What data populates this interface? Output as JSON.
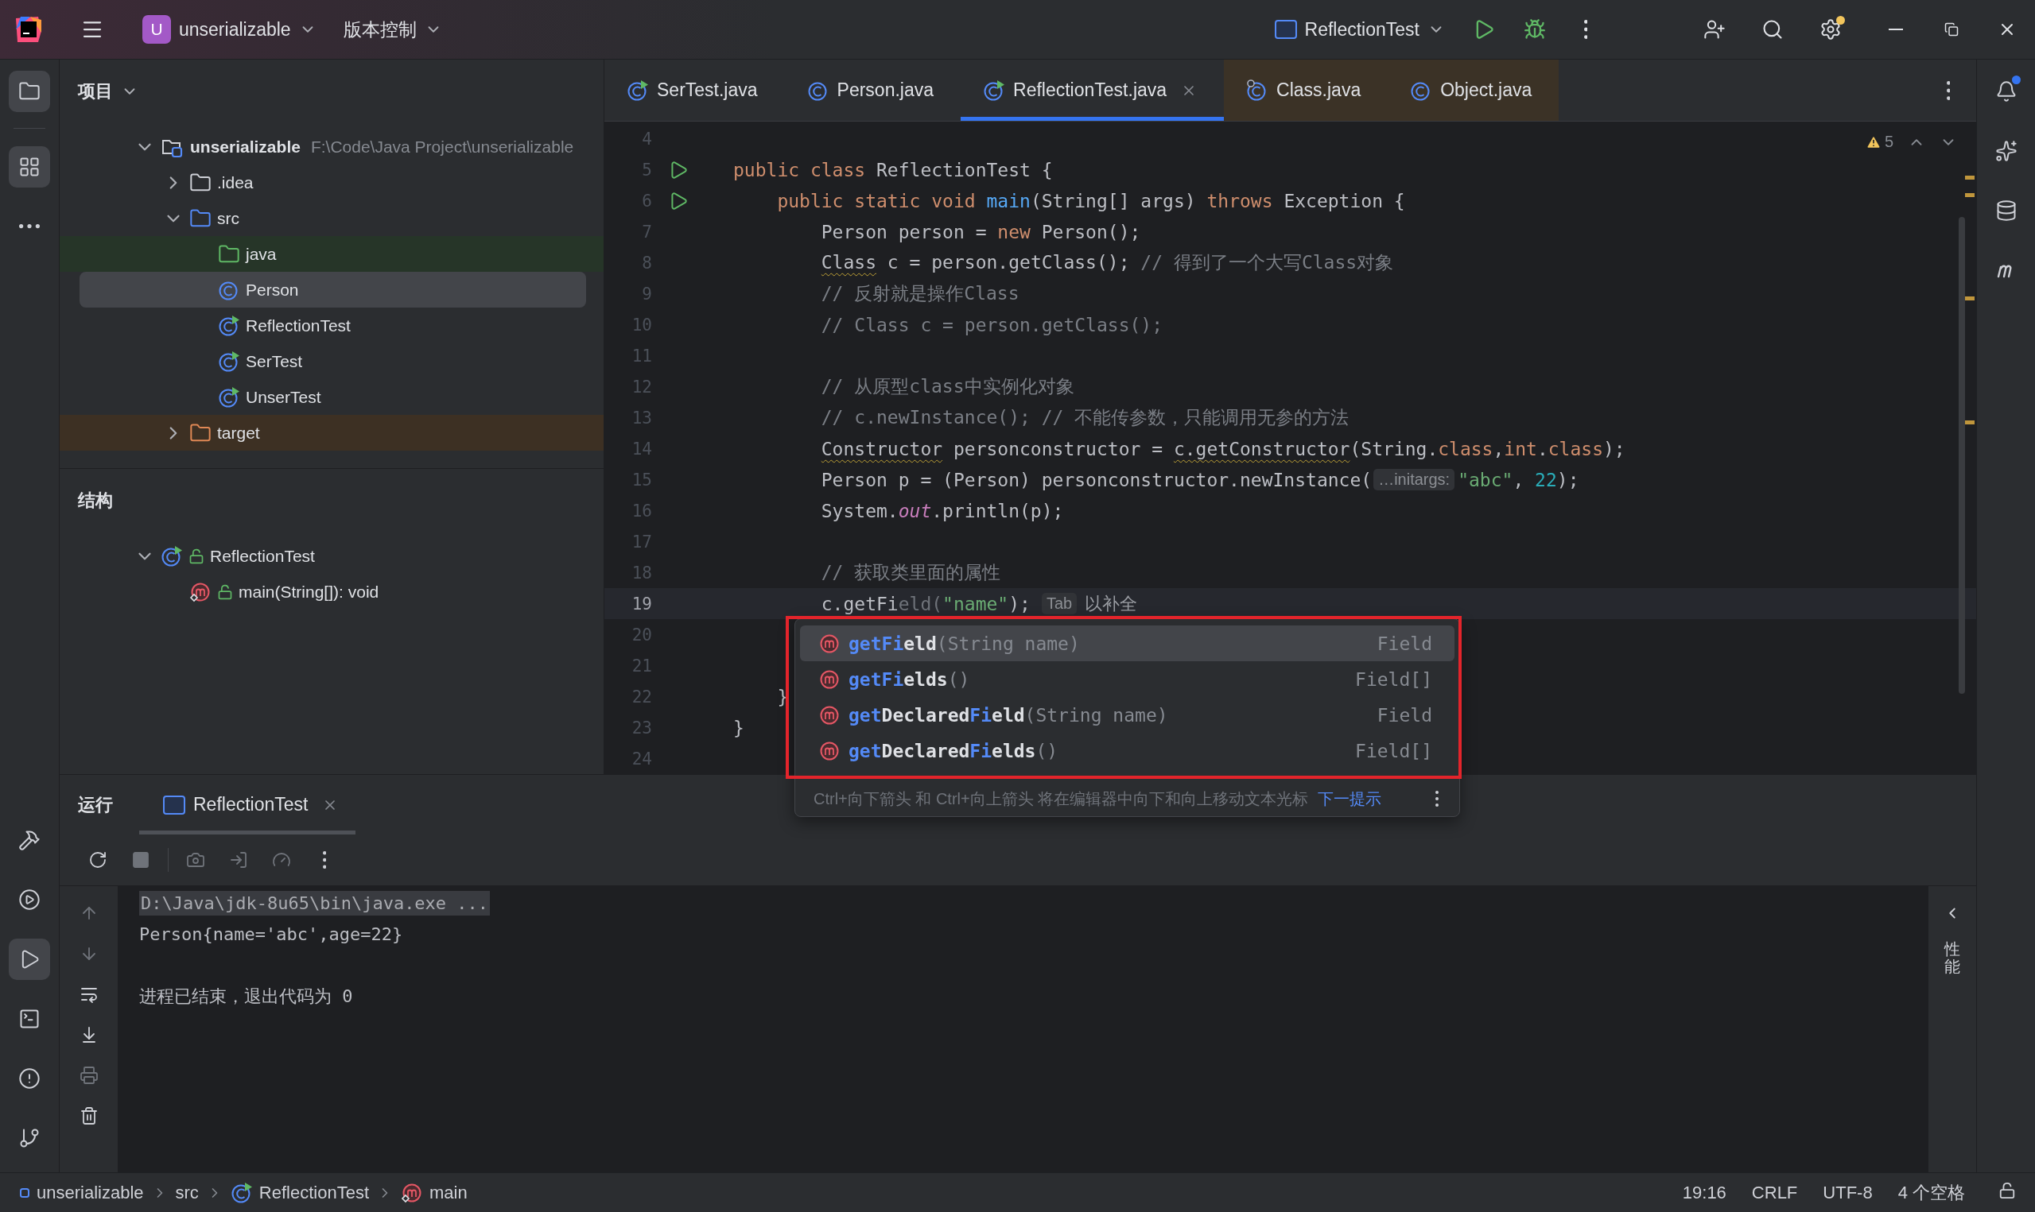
{
  "title_bar": {
    "project": {
      "badge": "U",
      "name": "unserializable"
    },
    "vcs": "版本控制",
    "run_config": "ReflectionTest",
    "settings_badge": true
  },
  "tool_strip": {
    "top": [
      {
        "kind": "project",
        "selected": true
      },
      {
        "kind": "structure",
        "selected": true
      },
      {
        "kind": "more",
        "selected": false
      }
    ],
    "bottom": [
      {
        "kind": "build",
        "selected": false
      },
      {
        "kind": "services",
        "selected": false
      },
      {
        "kind": "run",
        "selected": true
      },
      {
        "kind": "terminal",
        "selected": false
      },
      {
        "kind": "problems",
        "selected": false
      },
      {
        "kind": "git",
        "selected": false
      }
    ]
  },
  "project": {
    "title": "项目",
    "tree": [
      {
        "label": "unserializable",
        "path": "F:\\Code\\Java Project\\unserializable",
        "kind": "module",
        "expanded": true,
        "selected": false,
        "children": [
          {
            "label": ".idea",
            "kind": "folder",
            "expanded": false,
            "selected": false
          },
          {
            "label": "src",
            "kind": "source-folder",
            "expanded": true,
            "selected": false,
            "children": [
              {
                "label": "java",
                "kind": "root-folder",
                "selected": false,
                "color": "#263528"
              },
              {
                "label": "Person",
                "kind": "class",
                "selected": true
              },
              {
                "label": "ReflectionTest",
                "kind": "runnable-class",
                "selected": false
              },
              {
                "label": "SerTest",
                "kind": "runnable-class",
                "selected": false
              },
              {
                "label": "UnserTest",
                "kind": "runnable-class",
                "selected": false
              }
            ]
          },
          {
            "label": "target",
            "kind": "excluded-folder",
            "expanded": false,
            "selected": false,
            "color": "#3d3023"
          }
        ]
      }
    ]
  },
  "structure": {
    "title": "结构",
    "tree": [
      {
        "label": "ReflectionTest",
        "kind": "runnable-class",
        "public": true,
        "expanded": true,
        "selected": false,
        "children": [
          {
            "label": "main(String[]): void",
            "kind": "main-method",
            "public": true,
            "selected": false
          }
        ]
      }
    ]
  },
  "editor": {
    "tabs": [
      {
        "label": "SerTest.java",
        "kind": "runnable-class",
        "library": false,
        "selected": false
      },
      {
        "label": "Person.java",
        "kind": "class",
        "library": false,
        "selected": false
      },
      {
        "label": "ReflectionTest.java",
        "kind": "runnable-class",
        "library": false,
        "selected": true
      },
      {
        "label": "Class.java",
        "kind": "compiled-class",
        "library": true,
        "selected": false
      },
      {
        "label": "Object.java",
        "kind": "class",
        "library": true,
        "selected": false
      }
    ],
    "warnings": "5",
    "lines": [
      {
        "number": "4"
      },
      {
        "number": "5",
        "kind": "top",
        "run_marker": true,
        "tokens": [
          {
            "kind": "keyword",
            "text": "public class"
          },
          {
            "kind": "plain",
            "text": " ReflectionTest {"
          }
        ]
      },
      {
        "number": "6",
        "kind": "member",
        "run_marker": true,
        "tokens": [
          {
            "kind": "keyword",
            "text": "public static void"
          },
          {
            "kind": "method",
            "text": " main"
          },
          {
            "kind": "plain",
            "text": "(String[] args) "
          },
          {
            "kind": "keyword",
            "text": "throws"
          },
          {
            "kind": "plain",
            "text": " Exception {"
          }
        ]
      },
      {
        "number": "7",
        "kind": "statement",
        "tokens": [
          {
            "kind": "plain",
            "text": "Person person = "
          },
          {
            "kind": "keyword",
            "text": "new"
          },
          {
            "kind": "plain",
            "text": " Person();"
          }
        ]
      },
      {
        "number": "8",
        "kind": "statement",
        "tokens": [
          {
            "kind": "warn",
            "text": "Class"
          },
          {
            "kind": "plain",
            "text": " c = person.getClass(); "
          },
          {
            "kind": "comment",
            "text": "// 得到了一个大写Class对象"
          }
        ]
      },
      {
        "number": "9",
        "kind": "statement",
        "tokens": [
          {
            "kind": "comment",
            "text": "// 反射就是操作Class"
          }
        ]
      },
      {
        "number": "10",
        "kind": "statement",
        "tokens": [
          {
            "kind": "comment",
            "text": "// Class c = person.getClass();"
          }
        ]
      },
      {
        "number": "11"
      },
      {
        "number": "12",
        "kind": "statement",
        "tokens": [
          {
            "kind": "comment",
            "text": "// 从原型class中实例化对象"
          }
        ]
      },
      {
        "number": "13",
        "kind": "statement",
        "tokens": [
          {
            "kind": "comment",
            "text": "// c.newInstance(); // 不能传参数，只能调用无参的方法"
          }
        ]
      },
      {
        "number": "14",
        "kind": "statement",
        "tokens": [
          {
            "kind": "warn",
            "text": "Constructor"
          },
          {
            "kind": "plain",
            "text": " personconstructor = "
          },
          {
            "kind": "warn",
            "text": "c.getConstructor"
          },
          {
            "kind": "plain",
            "text": "(String."
          },
          {
            "kind": "keyword",
            "text": "class"
          },
          {
            "kind": "plain",
            "text": ","
          },
          {
            "kind": "keyword",
            "text": "int"
          },
          {
            "kind": "plain",
            "text": "."
          },
          {
            "kind": "keyword",
            "text": "class"
          },
          {
            "kind": "plain",
            "text": ");"
          }
        ]
      },
      {
        "number": "15",
        "kind": "statement",
        "tokens": [
          {
            "kind": "plain",
            "text": "Person p = (Person) personconstructor.newInstance("
          },
          {
            "kind": "inlay",
            "text": "…initargs:"
          },
          {
            "kind": "string",
            "text": "\"abc\""
          },
          {
            "kind": "plain",
            "text": ", "
          },
          {
            "kind": "number",
            "text": "22"
          },
          {
            "kind": "plain",
            "text": ");"
          }
        ]
      },
      {
        "number": "16",
        "kind": "statement",
        "tokens": [
          {
            "kind": "plain",
            "text": "System."
          },
          {
            "kind": "static",
            "text": "out"
          },
          {
            "kind": "plain",
            "text": ".println(p);"
          }
        ]
      },
      {
        "number": "17"
      },
      {
        "number": "18",
        "kind": "statement",
        "tokens": [
          {
            "kind": "comment",
            "text": "// 获取类里面的属性"
          }
        ]
      },
      {
        "number": "19",
        "kind": "statement",
        "current": true,
        "tokens": [
          {
            "kind": "plain",
            "text": "c.getFi"
          },
          {
            "kind": "ghost",
            "text": "eld("
          },
          {
            "kind": "string",
            "text": "\"name\""
          },
          {
            "kind": "plain",
            "text": ");"
          },
          {
            "kind": "key",
            "text": "Tab"
          },
          {
            "kind": "hint",
            "text": "以补全"
          }
        ]
      },
      {
        "number": "20"
      },
      {
        "number": "21"
      },
      {
        "number": "22",
        "kind": "member",
        "tokens": [
          {
            "kind": "plain",
            "text": "}"
          }
        ]
      },
      {
        "number": "23",
        "kind": "top",
        "tokens": [
          {
            "kind": "plain",
            "text": "}"
          }
        ]
      },
      {
        "number": "24"
      }
    ]
  },
  "completion": {
    "framed": true,
    "items": [
      {
        "name": [
          {
            "text": "getFi",
            "match": true
          },
          {
            "text": "eld",
            "match": false
          }
        ],
        "params": "(String name)",
        "type": "Field",
        "selected": true
      },
      {
        "name": [
          {
            "text": "getFi",
            "match": true
          },
          {
            "text": "elds",
            "match": false
          }
        ],
        "params": "()",
        "type": "Field[]",
        "selected": false
      },
      {
        "name": [
          {
            "text": "get",
            "match": true
          },
          {
            "text": "Declared",
            "match": false
          },
          {
            "text": "Fi",
            "match": true
          },
          {
            "text": "eld",
            "match": false
          }
        ],
        "params": "(String name)",
        "type": "Field",
        "selected": false
      },
      {
        "name": [
          {
            "text": "get",
            "match": true
          },
          {
            "text": "Declared",
            "match": false
          },
          {
            "text": "Fi",
            "match": true
          },
          {
            "text": "elds",
            "match": false
          }
        ],
        "params": "()",
        "type": "Field[]",
        "selected": false
      }
    ],
    "hint": "Ctrl+向下箭头 和 Ctrl+向上箭头 将在编辑器中向下和向上移动文本光标",
    "hint_link": "下一提示"
  },
  "run_panel": {
    "title": "运行",
    "tabs": [
      {
        "label": "ReflectionTest",
        "selected": true
      }
    ],
    "toolbar": [
      {
        "kind": "rerun",
        "disabled": false
      },
      {
        "kind": "stop",
        "disabled": true
      },
      {
        "kind": "snapshot",
        "disabled": true
      },
      {
        "kind": "attach",
        "disabled": true
      },
      {
        "kind": "profile",
        "disabled": true
      },
      {
        "kind": "more",
        "disabled": false
      }
    ],
    "side_tools": [
      {
        "kind": "up",
        "disabled": true
      },
      {
        "kind": "down",
        "disabled": true
      },
      {
        "kind": "wrap",
        "disabled": false
      },
      {
        "kind": "scroll-end",
        "disabled": false
      },
      {
        "kind": "print",
        "disabled": true
      },
      {
        "kind": "clear",
        "disabled": false
      }
    ],
    "output": [
      {
        "kind": "command",
        "text": "D:\\Java\\jdk-8u65\\bin\\java.exe ..."
      },
      {
        "kind": "output",
        "text": "Person{name='abc',age=22}"
      },
      {
        "kind": "exit",
        "text": "进程已结束，退出代码为 0"
      }
    ],
    "side_label": "性能"
  },
  "right_strip": [
    {
      "kind": "notifications",
      "badge": true
    },
    {
      "kind": "assistant"
    },
    {
      "kind": "database"
    },
    {
      "kind": "maven"
    }
  ],
  "status_bar": {
    "breadcrumbs": [
      {
        "kind": "module",
        "label": "unserializable"
      },
      {
        "label": "src"
      },
      {
        "kind": "runnable-class",
        "label": "ReflectionTest"
      },
      {
        "kind": "main-method",
        "label": "main"
      }
    ],
    "widgets": [
      "19:16",
      "CRLF",
      "UTF-8",
      "4 个空格"
    ]
  }
}
